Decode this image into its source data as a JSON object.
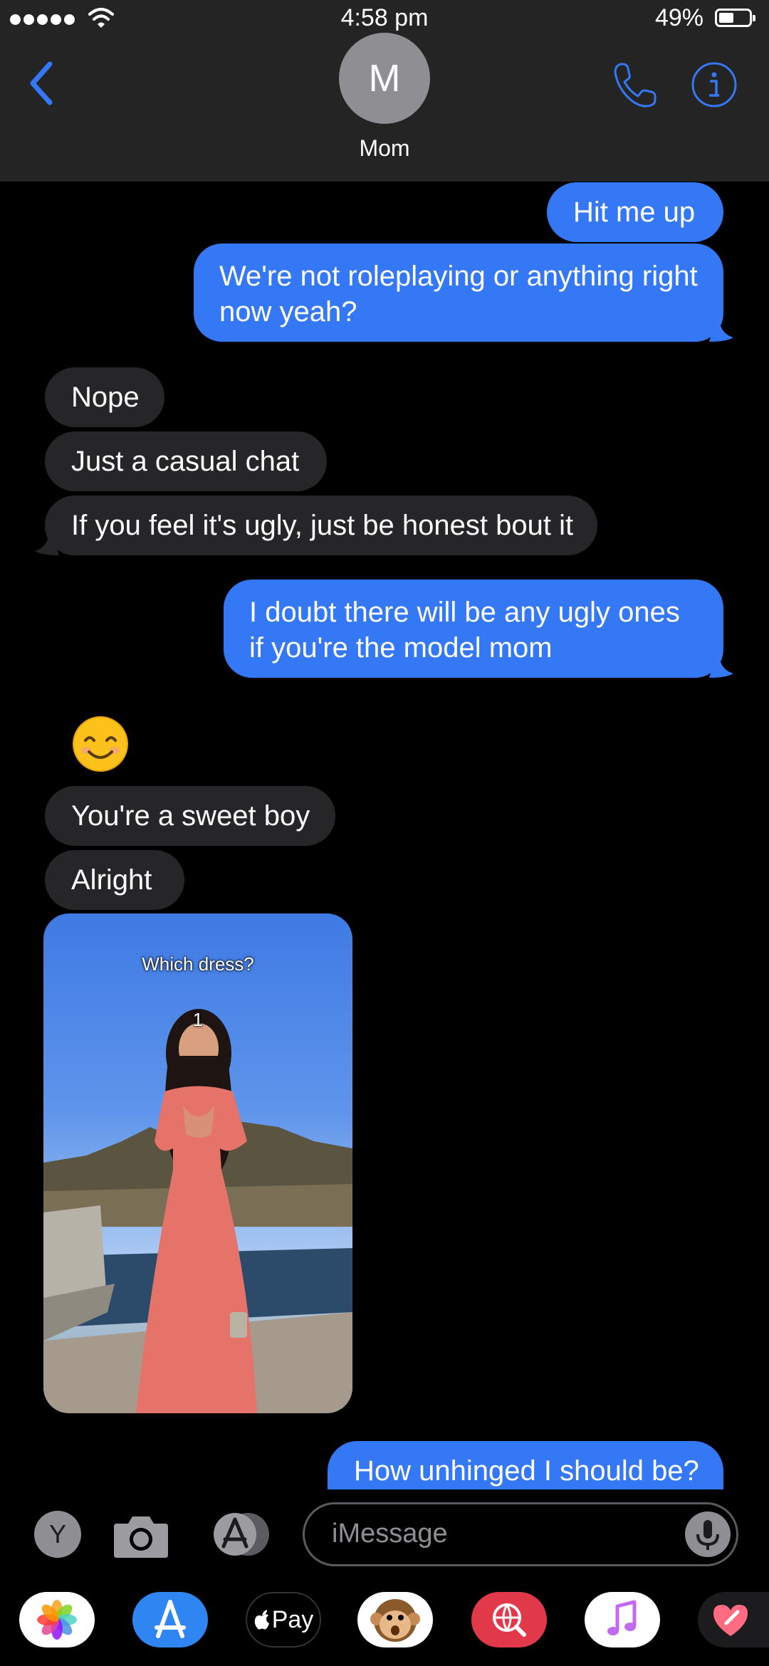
{
  "status_bar": {
    "time": "4:58 pm",
    "battery": "49%"
  },
  "header": {
    "avatar_initial": "M",
    "contact_name": "Mom"
  },
  "messages": [
    {
      "from": "me",
      "text": "Hit me up"
    },
    {
      "from": "me",
      "text": "We're not roleplaying or anything right now yeah?"
    },
    {
      "from": "them",
      "text": "Nope"
    },
    {
      "from": "them",
      "text": "Just a casual chat"
    },
    {
      "from": "them",
      "text": "If you feel it's ugly, just be honest bout it"
    },
    {
      "from": "me",
      "text": "I doubt there will be any ugly ones if you're the model mom"
    },
    {
      "from": "them",
      "text": "😊"
    },
    {
      "from": "them",
      "text": "You're a sweet boy"
    },
    {
      "from": "them",
      "text": "Alright"
    },
    {
      "from": "them",
      "image_caption": "Which dress?",
      "image_number": "1"
    },
    {
      "from": "me",
      "text": "How unhinged I should be?"
    }
  ],
  "input": {
    "avatar_letter": "Y",
    "placeholder": "iMessage"
  },
  "app_drawer": [
    {
      "name": "photos"
    },
    {
      "name": "app-store"
    },
    {
      "name": "apple-pay",
      "label": "Pay"
    },
    {
      "name": "animoji"
    },
    {
      "name": "web-images"
    },
    {
      "name": "music"
    },
    {
      "name": "digital-touch"
    }
  ],
  "colors": {
    "outgoing_bubble": "#3478f6",
    "incoming_bubble": "#262628",
    "accent": "#3478f6",
    "header_bg": "#242424"
  }
}
